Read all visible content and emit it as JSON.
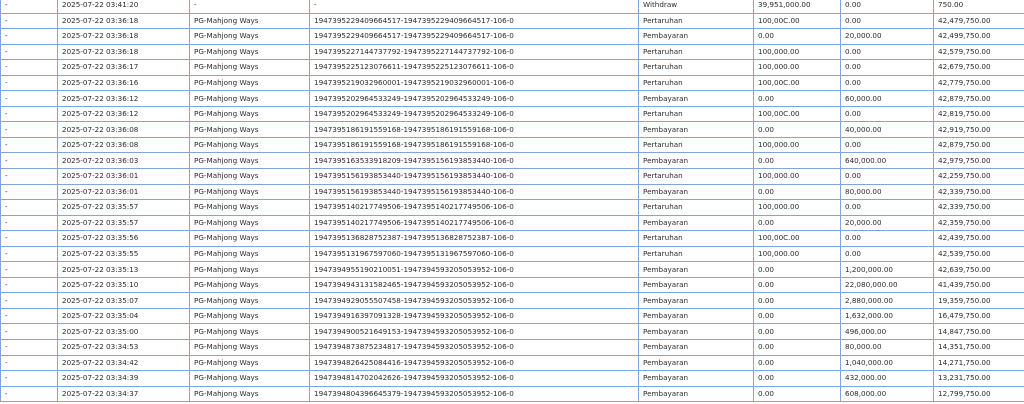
{
  "transactions": {
    "rows": [
      {
        "c0": "-",
        "time": "2025-07-22 03:41:20",
        "game": "-",
        "ref": "-",
        "type": "Withdraw",
        "debit": "39,951,000.00",
        "credit": "0.00",
        "balance": "750.00",
        "highlight": true
      },
      {
        "c0": "-",
        "time": "2025-07-22 03:36:18",
        "game": "PG-Mahjong Ways",
        "ref": "1947395229409664517-1947395229409664517-106-0",
        "type": "Pertaruhan",
        "debit": "100,00C.00",
        "credit": "0.00",
        "balance": "42,479,750.00"
      },
      {
        "c0": "-",
        "time": "2025-07-22 03:36:18",
        "game": "PG-Mahjong Ways",
        "ref": "1947395229409664517-1947395229409664517-106-0",
        "type": "Pembayaran",
        "debit": "0.00",
        "credit": "20,000.00",
        "balance": "42,499,750.00"
      },
      {
        "c0": "-",
        "time": "2025-07-22 03:36:18",
        "game": "PG-Mahjong Ways",
        "ref": "1947395227144737792-1947395227144737792-106-0",
        "type": "Pertaruhan",
        "debit": "100,000.00",
        "credit": "0.00",
        "balance": "42,579,750.00"
      },
      {
        "c0": "-",
        "time": "2025-07-22 03:36:17",
        "game": "PG-Mahjong Ways",
        "ref": "1947395225123076611-1947395225123076611-106-0",
        "type": "Pertaruhan",
        "debit": "100,000.00",
        "credit": "0.00",
        "balance": "42,679,750.00"
      },
      {
        "c0": "-",
        "time": "2025-07-22 03:36:16",
        "game": "PG-Mahjong Ways",
        "ref": "1947395219032960001-1947395219032960001-106-0",
        "type": "Pertaruhan",
        "debit": "100,00C.00",
        "credit": "0.00",
        "balance": "42,779,750.00"
      },
      {
        "c0": "-",
        "time": "2025-07-22 03:36:12",
        "game": "PG-Mahjong Ways",
        "ref": "1947395202964533249-1947395202964533249-106-0",
        "type": "Pembayaran",
        "debit": "0.00",
        "credit": "60,000.00",
        "balance": "42,879,750.00"
      },
      {
        "c0": "-",
        "time": "2025-07-22 03:36:12",
        "game": "PG-Mahjong Ways",
        "ref": "1947395202964533249-1947395202964533249-106-0",
        "type": "Pertaruhan",
        "debit": "100,00C.00",
        "credit": "0.00",
        "balance": "42,819,750.00"
      },
      {
        "c0": "-",
        "time": "2025-07-22 03:36:08",
        "game": "PG-Mahjong Ways",
        "ref": "1947395186191559168-1947395186191559168-106-0",
        "type": "Pembayaran",
        "debit": "0.00",
        "credit": "40,000.00",
        "balance": "42,919,750.00"
      },
      {
        "c0": "-",
        "time": "2025-07-22 03:36:08",
        "game": "PG-Mahjong Ways",
        "ref": "1947395186191559168-1947395186191559168-106-0",
        "type": "Pertaruhan",
        "debit": "100,000.00",
        "credit": "0.00",
        "balance": "42,879,750.00"
      },
      {
        "c0": "-",
        "time": "2025-07-22 03:36:03",
        "game": "PG-Mahjong Ways",
        "ref": "1947395163533918209-1947395156193853440-106-0",
        "type": "Pembayaran",
        "debit": "0.00",
        "credit": "640,000.00",
        "balance": "42,979,750.00"
      },
      {
        "c0": "-",
        "time": "2025-07-22 03:36:01",
        "game": "PG-Mahjong Ways",
        "ref": "1947395156193853440-1947395156193853440-106-0",
        "type": "Pertaruhan",
        "debit": "100,000.00",
        "credit": "0.00",
        "balance": "42,259,750.00"
      },
      {
        "c0": "-",
        "time": "2025-07-22 03:36:01",
        "game": "PG-Mahjong Ways",
        "ref": "1947395156193853440-1947395156193853440-106-0",
        "type": "Pembayaran",
        "debit": "0.00",
        "credit": "80,000.00",
        "balance": "42,339,750.00"
      },
      {
        "c0": "-",
        "time": "2025-07-22 03:35:57",
        "game": "PG-Mahjong Ways",
        "ref": "1947395140217749506-1947395140217749506-106-0",
        "type": "Pertaruhan",
        "debit": "100,000.00",
        "credit": "0.00",
        "balance": "42,339,750.00"
      },
      {
        "c0": "-",
        "time": "2025-07-22 03:35:57",
        "game": "PG-Mahjong Ways",
        "ref": "1947395140217749506-1947395140217749506-106-0",
        "type": "Pembayaran",
        "debit": "0.00",
        "credit": "20,000.00",
        "balance": "42,359,750.00"
      },
      {
        "c0": "-",
        "time": "2025-07-22 03:35:56",
        "game": "PG-Mahjong Ways",
        "ref": "1947395136828752387-1947395136828752387-106-0",
        "type": "Pertaruhan",
        "debit": "100,00C.00",
        "credit": "0.00",
        "balance": "42,439,750.00"
      },
      {
        "c0": "-",
        "time": "2025-07-22 03:35:55",
        "game": "PG-Mahjong Ways",
        "ref": "1947395131967597060-1947395131967597060-106-0",
        "type": "Pertaruhan",
        "debit": "100,000.00",
        "credit": "0.00",
        "balance": "42,539,750.00"
      },
      {
        "c0": "-",
        "time": "2025-07-22 03:35:13",
        "game": "PG-Mahjong Ways",
        "ref": "1947394955190210051-1947394593205053952-106-0",
        "type": "Pembayaran",
        "debit": "0.00",
        "credit": "1,200,000.00",
        "balance": "42,639,750.00"
      },
      {
        "c0": "-",
        "time": "2025-07-22 03:35:10",
        "game": "PG-Mahjong Ways",
        "ref": "1947394943131582465-1947394593205053952-106-0",
        "type": "Pembayaran",
        "debit": "0.00",
        "credit": "22,080,000.00",
        "balance": "41,439,750.00"
      },
      {
        "c0": "-",
        "time": "2025-07-22 03:35:07",
        "game": "PG-Mahjong Ways",
        "ref": "1947394929055507458-1947394593205053952-106-0",
        "type": "Pembayaran",
        "debit": "0.00",
        "credit": "2,880,000.00",
        "balance": "19,359,750.00"
      },
      {
        "c0": "-",
        "time": "2025-07-22 03:35:04",
        "game": "PG-Mahjong Ways",
        "ref": "1947394916397091328-1947394593205053952-106-0",
        "type": "Pembayaran",
        "debit": "0.00",
        "credit": "1,632,000.00",
        "balance": "16,479,750.00"
      },
      {
        "c0": "-",
        "time": "2025-07-22 03:35:00",
        "game": "PG-Mahjong Ways",
        "ref": "1947394900521649153-1947394593205053952-106-0",
        "type": "Pembayaran",
        "debit": "0.00",
        "credit": "496,000.00",
        "balance": "14,847,750.00"
      },
      {
        "c0": "-",
        "time": "2025-07-22 03:34:53",
        "game": "PG-Mahjong Ways",
        "ref": "1947394873875234817-1947394593205053952-106-0",
        "type": "Pembayaran",
        "debit": "0.00",
        "credit": "80,000.00",
        "balance": "14,351,750.00"
      },
      {
        "c0": "-",
        "time": "2025-07-22 03:34:42",
        "game": "PG-Mahjong Ways",
        "ref": "1947394826425084416-1947394593205053952-106-0",
        "type": "Pembayaran",
        "debit": "0.00",
        "credit": "1,040,000.00",
        "balance": "14,271,750.00"
      },
      {
        "c0": "-",
        "time": "2025-07-22 03:34:39",
        "game": "PG-Mahjong Ways",
        "ref": "1947394814702042626-1947394593205053952-106-0",
        "type": "Pembayaran",
        "debit": "0.00",
        "credit": "432,000.00",
        "balance": "13,231,750.00"
      },
      {
        "c0": "-",
        "time": "2025-07-22 03:34:37",
        "game": "PG-Mahjong Ways",
        "ref": "1947394804396645379-1947394593205053952-106-0",
        "type": "Pembayaran",
        "debit": "0.00",
        "credit": "608,000.00",
        "balance": "12,799,750.00"
      }
    ]
  },
  "colors": {
    "link": "#2f7fc7",
    "negative": "#e02020",
    "border": "#7fa6d6",
    "text": "#2c2c2c"
  }
}
